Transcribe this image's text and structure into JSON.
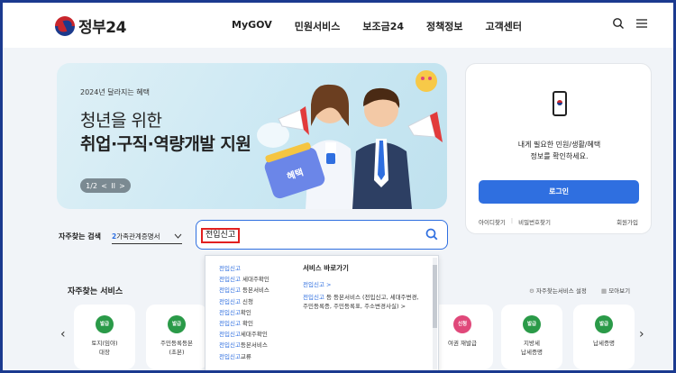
{
  "header": {
    "logo_text": "정부24",
    "nav": [
      "MyGOV",
      "민원서비스",
      "보조금24",
      "정책정보",
      "고객센터"
    ],
    "icons": [
      "search-icon",
      "menu-icon"
    ]
  },
  "banner": {
    "small": "2024년 달라지는 혜택",
    "title_line1": "청년을 위한",
    "title_line2": "취업·구직·역량개발 지원",
    "pager_text": "1/2",
    "pager_prev": "<",
    "pager_pause": "II",
    "pager_next": ">",
    "calendar_label": "혜택"
  },
  "login_card": {
    "msg_line1": "내게 필요한 민원/생활/혜택",
    "msg_line2": "정보를 확인하세요.",
    "login_button": "로그인",
    "find_id": "아이디찾기",
    "separator": "|",
    "find_pw": "비밀번호찾기",
    "join": "회원가입"
  },
  "search": {
    "label": "자주찾는 검색",
    "select_num": "2",
    "select_text": "가족관계증명서",
    "query": "전입신고"
  },
  "dropdown": {
    "suggestions": [
      {
        "hl": "전입신고",
        "rest": ""
      },
      {
        "hl": "전입신고",
        "rest": " 세대주확인"
      },
      {
        "hl": "전입신고",
        "rest": " 등본서비스"
      },
      {
        "hl": "전입신고",
        "rest": " 신청"
      },
      {
        "hl": "전입신고",
        "rest": "확인"
      },
      {
        "hl": "전입신고",
        "rest": " 확인"
      },
      {
        "hl": "전입신고",
        "rest": "세대주확인"
      },
      {
        "hl": "전입신고",
        "rest": "등본서비스"
      },
      {
        "hl": "전입신고",
        "rest": "교류"
      }
    ],
    "shortcut_head": "서비스 바로가기",
    "shortcut1": "전입신고 >",
    "shortcut2_hl": "전입신고",
    "shortcut2_rest": " 등 등본서비스 (전입신고, 세대주변경, 주민등록증, 주민등록표, 주소변경사실)",
    "shortcut2_arrow": ">"
  },
  "favorites": {
    "title": "자주찾는 서비스",
    "settings": "자주찾는서비스 설정",
    "view_all": "모아보기",
    "items": [
      {
        "badge": "발급",
        "label1": "토지(임야)",
        "label2": "대장",
        "color": "#2a9a48"
      },
      {
        "badge": "발급",
        "label1": "주민등록등본",
        "label2": "(초본)",
        "color": "#2a9a48"
      },
      {
        "badge": "신청",
        "label1": "여권 재발급",
        "label2": "",
        "color": "#e0487a"
      },
      {
        "badge": "발급",
        "label1": "지방세",
        "label2": "납세증명",
        "color": "#2a9a48"
      },
      {
        "badge": "발급",
        "label1": "납세증명",
        "label2": "",
        "color": "#2a9a48"
      }
    ]
  }
}
